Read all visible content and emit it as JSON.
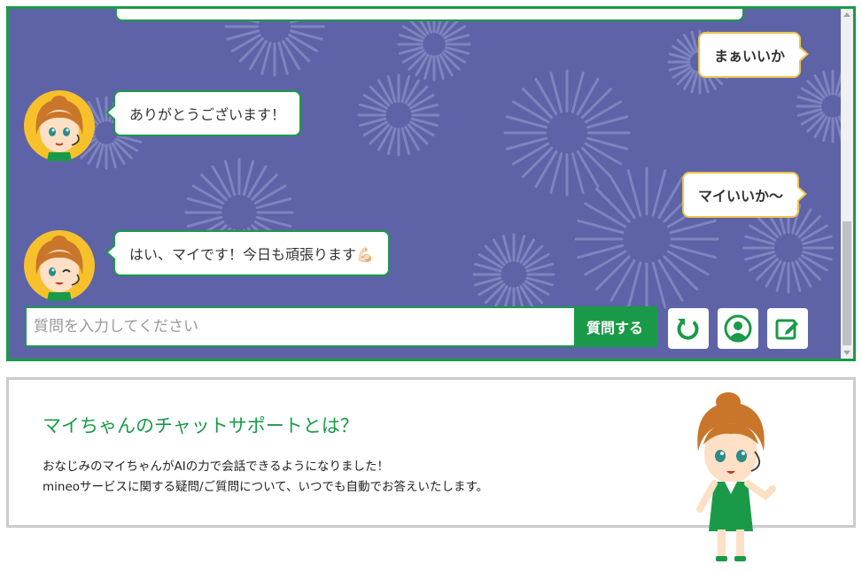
{
  "chat": {
    "messages": [
      {
        "sender": "user",
        "text": "まぁいいか"
      },
      {
        "sender": "bot",
        "text": "ありがとうございます！"
      },
      {
        "sender": "user",
        "text": "マイいいか〜"
      },
      {
        "sender": "bot",
        "text": "はい、マイです！今日も頑張ります💪🏻"
      }
    ],
    "input": {
      "value": "",
      "placeholder": "質問を入力してください"
    },
    "send_label": "質問する",
    "tools": [
      {
        "icon": "refresh-icon"
      },
      {
        "icon": "user-profile-icon"
      },
      {
        "icon": "edit-icon"
      }
    ]
  },
  "info": {
    "title": "マイちゃんのチャットサポートとは？",
    "line1": "おなじみのマイちゃんがAIの力で会話できるようになりました！",
    "line2": "mineoサービスに関する疑問/ご質問について、いつでも自動でお答えいたします。"
  },
  "colors": {
    "brand_green": "#1a9a48",
    "chat_background": "#5d63a6",
    "user_bubble_border": "#f0c24a",
    "info_border": "#cccccc"
  }
}
